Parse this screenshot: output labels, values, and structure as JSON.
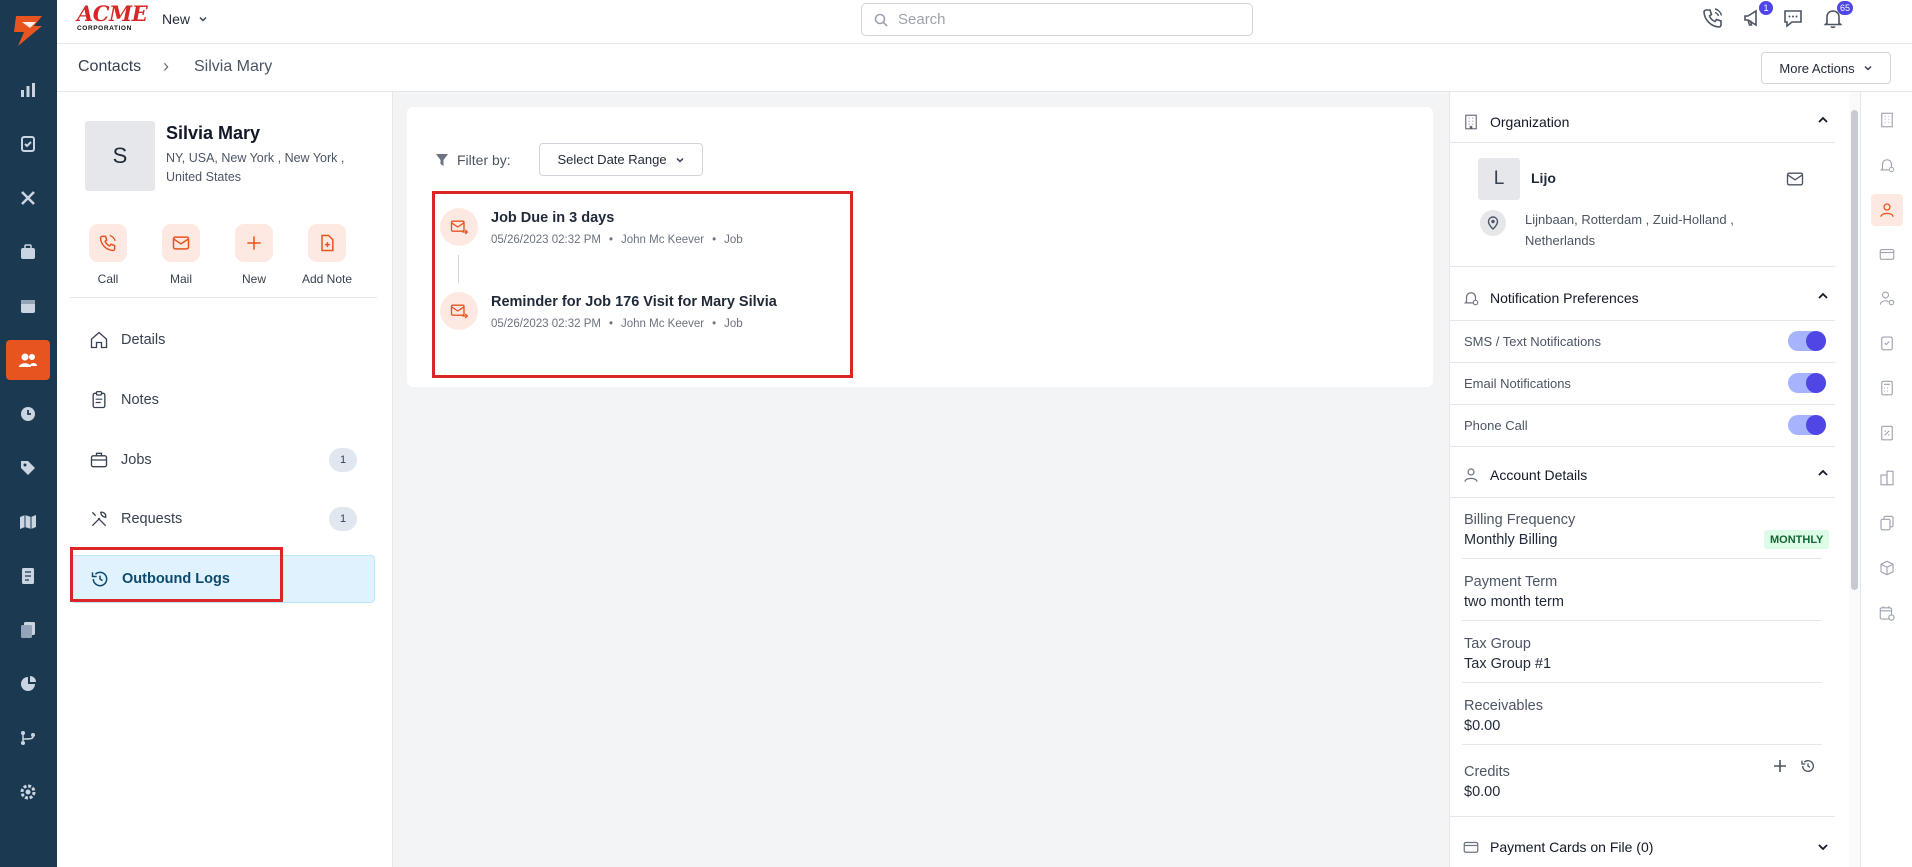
{
  "topbar": {
    "logo_text": "ACME",
    "logo_sub": "CORPORATION",
    "new_label": "New",
    "search_placeholder": "Search",
    "megaphone_badge": "1",
    "bell_badge": "65"
  },
  "breadcrumb": {
    "root": "Contacts",
    "separator": "›",
    "current": "Silvia Mary",
    "more_actions": "More Actions"
  },
  "contact": {
    "initial": "S",
    "name": "Silvia Mary",
    "address": "NY, USA, New York , New York , United States",
    "actions": [
      {
        "label": "Call",
        "icon": "phone-icon"
      },
      {
        "label": "Mail",
        "icon": "mail-icon"
      },
      {
        "label": "New",
        "icon": "plus-icon"
      },
      {
        "label": "Add Note",
        "icon": "add-note-icon"
      }
    ],
    "nav": [
      {
        "label": "Details",
        "icon": "home-icon",
        "count": ""
      },
      {
        "label": "Notes",
        "icon": "clipboard-icon",
        "count": ""
      },
      {
        "label": "Jobs",
        "icon": "briefcase-icon",
        "count": "1"
      },
      {
        "label": "Requests",
        "icon": "tools-icon",
        "count": "1"
      },
      {
        "label": "Outbound Logs",
        "icon": "history-icon",
        "count": "",
        "active": true
      }
    ]
  },
  "logs": {
    "filter_label": "Filter by:",
    "date_range": "Select Date Range",
    "items": [
      {
        "title": "Job Due in 3 days",
        "date": "05/26/2023 02:32 PM",
        "user": "John Mc Keever",
        "type": "Job"
      },
      {
        "title": "Reminder for Job 176 Visit for Mary Silvia",
        "date": "05/26/2023 02:32 PM",
        "user": "John Mc Keever",
        "type": "Job"
      }
    ],
    "dot": "•"
  },
  "organization": {
    "heading": "Organization",
    "initial": "L",
    "name": "Lijo",
    "address": "Lijnbaan, Rotterdam , Zuid-Holland , Netherlands"
  },
  "notifications": {
    "heading": "Notification Preferences",
    "items": [
      {
        "label": "SMS / Text Notifications",
        "on": true
      },
      {
        "label": "Email Notifications",
        "on": true
      },
      {
        "label": "Phone Call",
        "on": true
      }
    ]
  },
  "account": {
    "heading": "Account Details",
    "billing_label": "Billing Frequency",
    "billing_value": "Monthly Billing",
    "billing_badge": "MONTHLY",
    "payment_label": "Payment Term",
    "payment_value": "two month term",
    "tax_label": "Tax Group",
    "tax_value": "Tax Group #1",
    "receivables_label": "Receivables",
    "receivables_value": "$0.00",
    "credits_label": "Credits",
    "credits_value": "$0.00",
    "payment_cards": "Payment Cards on File (0)"
  },
  "colors": {
    "brand_orange": "#e8541f",
    "rail_navy": "#1b3a52",
    "accent_indigo": "#4f46e5",
    "highlight_red": "#dc2626"
  }
}
